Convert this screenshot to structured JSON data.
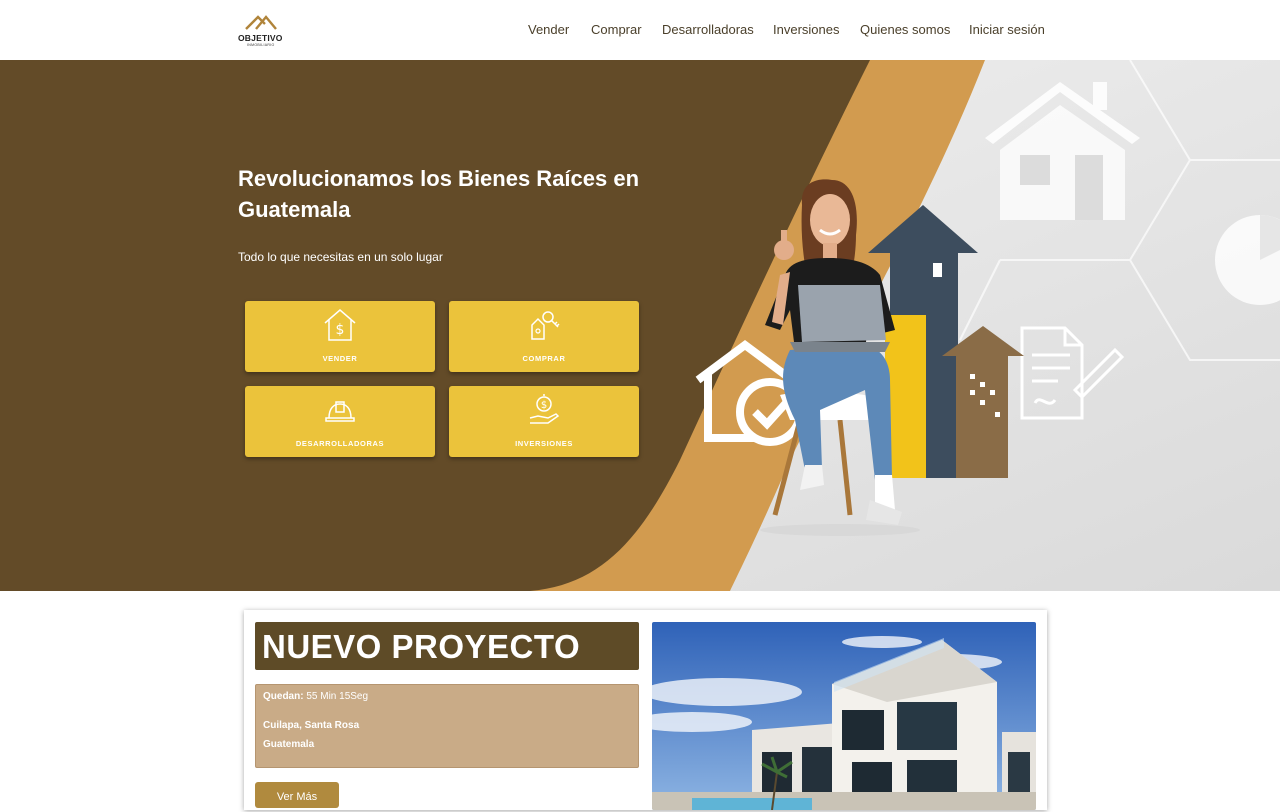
{
  "brand": {
    "name": "OBJETIVO",
    "tagline": "INMOBILIARIO"
  },
  "nav": {
    "items": [
      {
        "label": "Vender"
      },
      {
        "label": "Comprar"
      },
      {
        "label": "Desarrolladoras"
      },
      {
        "label": "Inversiones"
      },
      {
        "label": "Quienes somos"
      },
      {
        "label": "Iniciar sesión"
      }
    ]
  },
  "hero": {
    "title": "Revolucionamos los Bienes Raíces en Guatemala",
    "subtitle": "Todo lo que necesitas en un solo lugar",
    "cards": [
      {
        "label": "VENDER",
        "icon": "house-dollar-icon"
      },
      {
        "label": "COMPRAR",
        "icon": "house-key-icon"
      },
      {
        "label": "DESARROLLADORAS",
        "icon": "hard-hat-icon"
      },
      {
        "label": "INVERSIONES",
        "icon": "hand-coin-icon"
      }
    ]
  },
  "project": {
    "heading": "NUEVO PROYECTO",
    "countdown_label": "Quedan:",
    "countdown_value": "55 Min 15Seg",
    "location_line1": "Cuilapa, Santa Rosa",
    "location_line2": "Guatemala",
    "button_label": "Ver Más"
  },
  "colors": {
    "hero_brown": "#634b28",
    "hero_orange": "#d29b4f",
    "card_yellow": "#ebc33b",
    "project_title_bg": "#5e4b27",
    "project_info_bg": "#c9ab87",
    "button_bg": "#b08a3e"
  }
}
